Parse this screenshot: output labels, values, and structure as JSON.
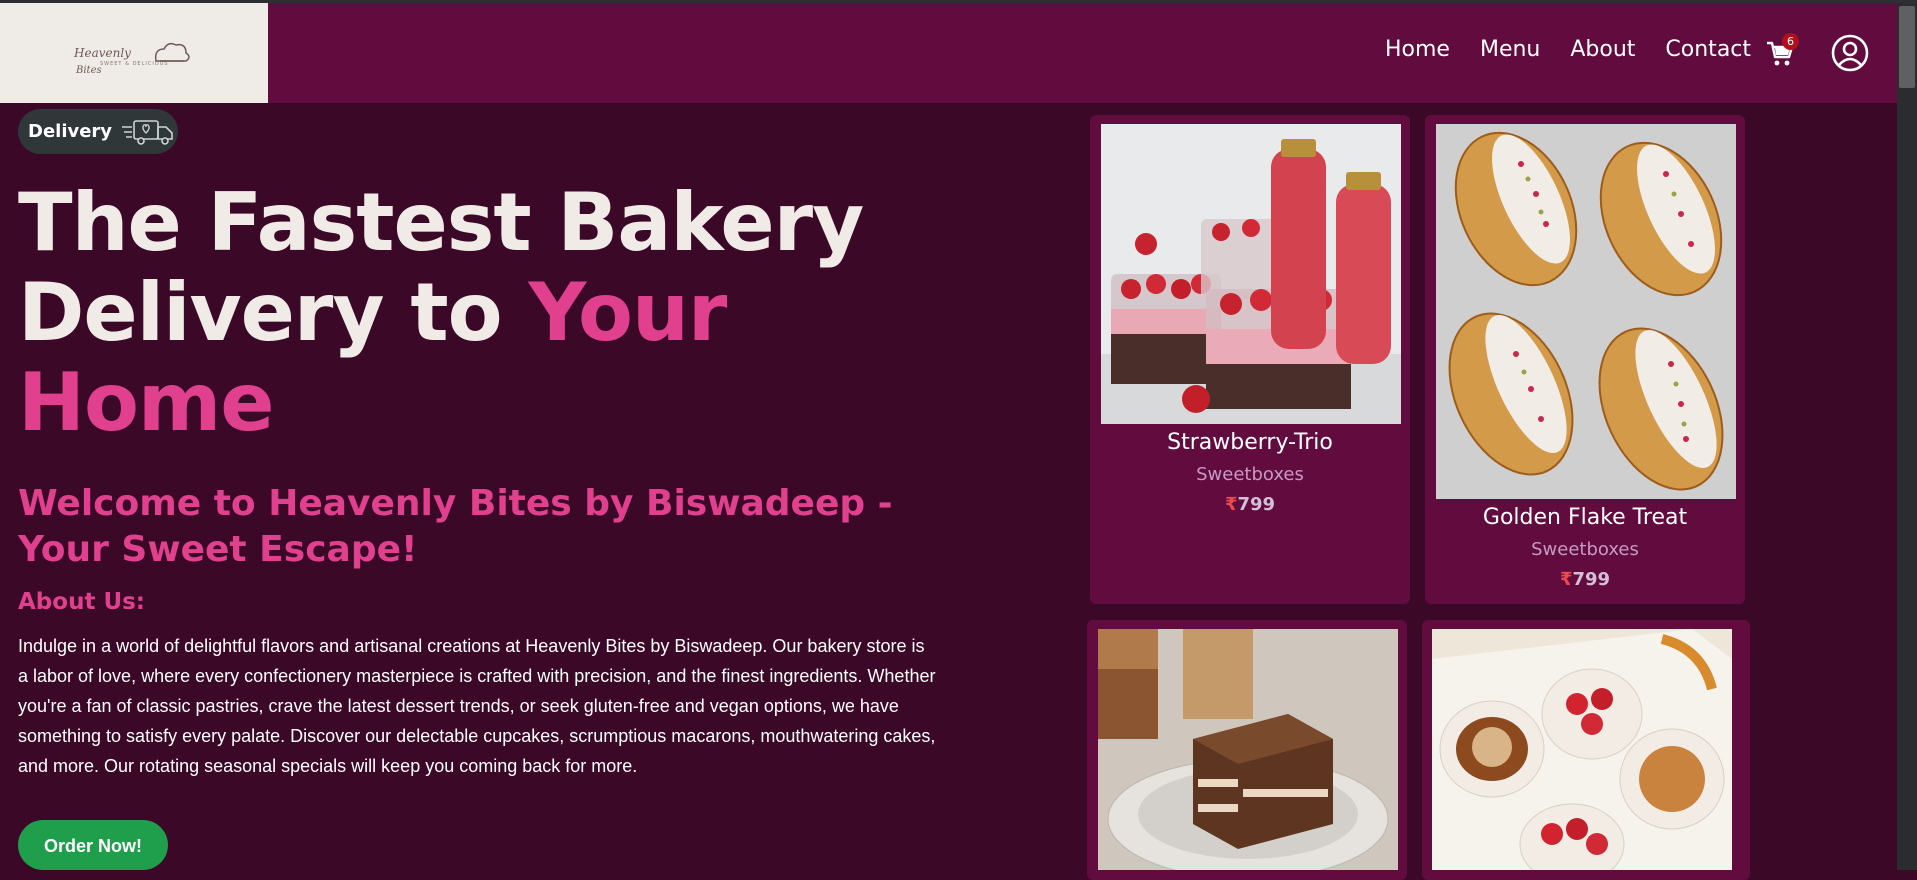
{
  "brand": {
    "logo_line1": "Heavenly",
    "logo_sub": "SWEET & DELICIOUS",
    "logo_line2": "Bites"
  },
  "nav": {
    "items": [
      "Home",
      "Menu",
      "About",
      "Contact"
    ],
    "cart_count": "6"
  },
  "hero": {
    "badge": "Delivery",
    "title_1": "The Fastest Bakery",
    "title_2": "Delivery to ",
    "title_accent": "Your Home",
    "welcome": "Welcome to Heavenly Bites by Biswadeep - Your Sweet Escape!",
    "about_heading": "About Us:",
    "about_text": "Indulge in a world of delightful flavors and artisanal creations at Heavenly Bites by Biswadeep. Our bakery store is a labor of love, where every confectionery masterpiece is crafted with precision, and the finest ingredients. Whether you're a fan of classic pastries, crave the latest dessert trends, or seek gluten-free and vegan options, we have something to satisfy every palate. Discover our delectable cupcakes, scrumptious macarons, mouthwatering cakes, and more. Our rotating seasonal specials will keep you coming back for more.",
    "cta": "Order Now!"
  },
  "products": [
    {
      "name": "Strawberry-Trio",
      "category": "Sweetboxes",
      "currency": "₹",
      "price": "799"
    },
    {
      "name": "Golden Flake Treat",
      "category": "Sweetboxes",
      "currency": "₹",
      "price": "799"
    },
    {
      "name": "",
      "category": "",
      "currency": "",
      "price": ""
    },
    {
      "name": "",
      "category": "",
      "currency": "",
      "price": ""
    }
  ],
  "colors": {
    "nav_bg": "#620b3e",
    "page_bg": "#3b0828",
    "accent": "#e0408e",
    "cta": "#1f9e4c"
  },
  "icons": [
    "delivery-truck-icon",
    "cart-icon",
    "user-circle-icon"
  ]
}
